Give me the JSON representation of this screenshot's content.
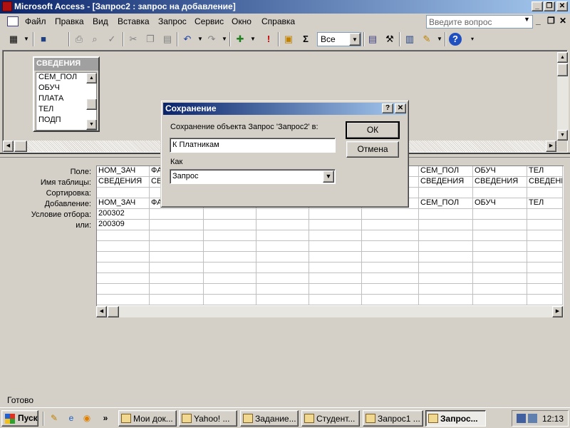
{
  "window": {
    "title": "Microsoft Access - [Запрос2 : запрос на добавление]",
    "caption_minimize": "_",
    "caption_restore": "❐",
    "caption_close": "✕"
  },
  "menubar": {
    "items": [
      "Файл",
      "Правка",
      "Вид",
      "Вставка",
      "Запрос",
      "Сервис",
      "Окно",
      "Справка"
    ],
    "ask_placeholder": "Введите вопрос",
    "mdi_min": "_",
    "mdi_restore": "❐",
    "mdi_close": "✕"
  },
  "toolbar": {
    "top_values_combo": "Все",
    "sigma_label": "Σ",
    "run_label": "!"
  },
  "table_box": {
    "title": "СВЕДЕНИЯ",
    "fields": [
      "СЕМ_ПОЛ",
      "ОБУЧ",
      "ПЛАТА",
      "ТЕЛ",
      "ПОДП"
    ]
  },
  "grid": {
    "row_labels": [
      "Поле:",
      "Имя таблицы:",
      "Сортировка:",
      "Добавление:",
      "Условие отбора:",
      "или:"
    ],
    "columns": [
      {
        "field": "НОМ_ЗАЧ",
        "table": "СВЕДЕНИЯ",
        "sort": "",
        "append": "НОМ_ЗАЧ",
        "criteria": "200302",
        "or": "200309"
      },
      {
        "field": "ФА",
        "table": "СВ",
        "sort": "",
        "append": "ФА",
        "criteria": "",
        "or": ""
      },
      {
        "field": "",
        "table": "",
        "sort": "",
        "append": "",
        "criteria": "",
        "or": ""
      },
      {
        "field": "",
        "table": "",
        "sort": "",
        "append": "",
        "criteria": "",
        "or": ""
      },
      {
        "field": "",
        "table": "",
        "sort": "",
        "append": "",
        "criteria": "",
        "or": ""
      },
      {
        "field": "",
        "table": "",
        "sort": "",
        "append": "",
        "criteria": "",
        "or": ""
      },
      {
        "field": "СЕМ_ПОЛ",
        "table": "СВЕДЕНИЯ",
        "sort": "",
        "append": "СЕМ_ПОЛ",
        "criteria": "",
        "or": ""
      },
      {
        "field": "ОБУЧ",
        "table": "СВЕДЕНИЯ",
        "sort": "",
        "append": "ОБУЧ",
        "criteria": "",
        "or": ""
      },
      {
        "field": "ТЕЛ",
        "table": "СВЕДЕНИ...",
        "sort": "",
        "append": "ТЕЛ",
        "criteria": "",
        "or": ""
      }
    ]
  },
  "dialog": {
    "title": "Сохранение",
    "help_btn": "?",
    "close_btn": "✕",
    "prompt": "Сохранение объекта Запрос 'Запрос2' в:",
    "name_value": "К Платникам",
    "as_label": "Как",
    "as_value": "Запрос",
    "ok_label": "ОК",
    "cancel_label": "Отмена"
  },
  "statusbar": {
    "text": "Готово"
  },
  "taskbar": {
    "start_label": "Пуск",
    "more": "»",
    "tasks": [
      {
        "label": "Мои док...",
        "active": false
      },
      {
        "label": "Yahoo! ...",
        "active": false
      },
      {
        "label": "Задание...",
        "active": false
      },
      {
        "label": "Студент...",
        "active": false
      },
      {
        "label": "Запрос1 ...",
        "active": false
      },
      {
        "label": "Запрос...",
        "active": true
      }
    ],
    "clock": "12:13"
  },
  "colors": {
    "title_active": "#0a246a",
    "title_gradient_end": "#a6caf0",
    "face": "#d4d0c8"
  }
}
